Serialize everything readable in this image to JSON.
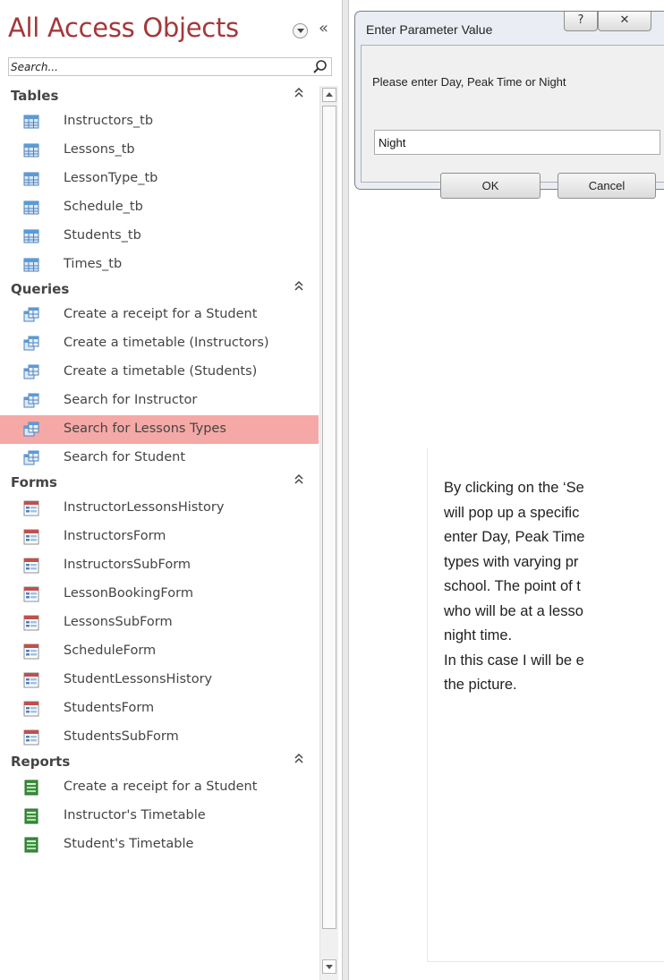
{
  "nav": {
    "title": "All Access Objects",
    "search_placeholder": "Search...",
    "menu_icon": "chevron-down-circle-icon",
    "collapse_icon": "double-chevron-left-icon",
    "groups": [
      {
        "label": "Tables",
        "icon": "table-icon",
        "items": [
          "Instructors_tb",
          "Lessons_tb",
          "LessonType_tb",
          "Schedule_tb",
          "Students_tb",
          "Times_tb"
        ]
      },
      {
        "label": "Queries",
        "icon": "query-icon",
        "items": [
          "Create a receipt for a Student",
          "Create a timetable (Instructors)",
          "Create a timetable (Students)",
          "Search for Instructor",
          "Search for Lessons Types",
          "Search for Student"
        ],
        "selected_item": "Search for Lessons Types"
      },
      {
        "label": "Forms",
        "icon": "form-icon",
        "items": [
          "InstructorLessonsHistory",
          "InstructorsForm",
          "InstructorsSubForm",
          "LessonBookingForm",
          "LessonsSubForm",
          "ScheduleForm",
          "StudentLessonsHistory",
          "StudentsForm",
          "StudentsSubForm"
        ]
      },
      {
        "label": "Reports",
        "icon": "report-icon",
        "items": [
          "Create a receipt for a Student",
          "Instructor's Timetable",
          "Student's Timetable"
        ]
      }
    ]
  },
  "dialog": {
    "title": "Enter Parameter Value",
    "help_label": "?",
    "close_label": "✕",
    "prompt": "Please enter Day, Peak Time or Night",
    "input_value": "Night",
    "ok_label": "OK",
    "cancel_label": "Cancel"
  },
  "doc": {
    "lines": [
      "By clicking on the ‘Se",
      "will pop up  a specific",
      "enter Day, Peak Time",
      "types with varying pr",
      "school. The point of t",
      "who will be at a lesso",
      "night time.",
      "In this case I will be e",
      "the picture."
    ]
  },
  "colors": {
    "title": "#a4373a",
    "selected_bg": "#f5a9a6",
    "table_icon": "#5b9bd5",
    "form_icon": "#c0504d",
    "report_icon": "#3a8f3a"
  }
}
